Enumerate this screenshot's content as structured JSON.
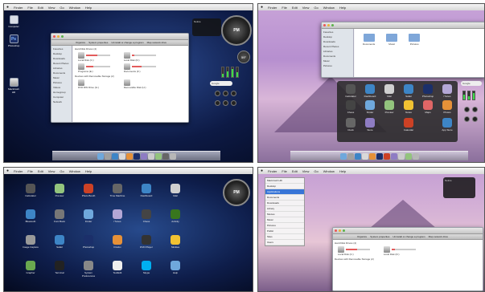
{
  "menubar": {
    "apple": "",
    "items": [
      "Finder",
      "File",
      "Edit",
      "View",
      "Go",
      "Window",
      "Help"
    ]
  },
  "panel1": {
    "desktop_icons": [
      "Computer",
      "Photoshop",
      "Macintosh HD"
    ],
    "window": {
      "tabs": [
        "Organize",
        "System properties",
        "Uninstall or change a program",
        "Map network drive"
      ],
      "sidebar": [
        "Favorites",
        "Desktop",
        "Downloads",
        "Recent Places",
        "Libraries",
        "Documents",
        "Music",
        "Pictures",
        "Videos",
        "Homegroup",
        "Computer",
        "Network"
      ],
      "hard_disk_header": "Hard Disk Drives (4)",
      "removable_header": "Devices with Removable Storage (2)",
      "drives": [
        {
          "name": "Local Disk (C:)",
          "free": 0.55
        },
        {
          "name": "Local Disk (D:)",
          "free": 0.88
        },
        {
          "name": "Programs (E:)",
          "free": 0.7
        },
        {
          "name": "Documents (F:)",
          "free": 0.6
        }
      ],
      "removable": [
        "DVD RW Drive (G:)",
        "Removable Disk (H:)"
      ]
    },
    "clock": "PM",
    "temp": "59°",
    "search": "Google",
    "meters": [
      0.35,
      0.6,
      0.85,
      0.5
    ],
    "notice": "Notice"
  },
  "panel2": {
    "finder_sidebar": [
      "Favorites",
      "Desktop",
      "Downloads",
      "Recent Places",
      "Libraries",
      "Documents",
      "Music",
      "Pictures"
    ],
    "folders": [
      "Documents",
      "Music",
      "Pictures"
    ],
    "search": "Google",
    "launchpad_labels": [
      "Calculator",
      "Dashboard",
      "Mail",
      "Safari",
      "Photoshop",
      "iTunes",
      "Chess",
      "Finder",
      "Preview",
      "Notes",
      "Maps",
      "Photos",
      "Clock",
      "Store",
      "Calendar",
      "App Store"
    ]
  },
  "panel3": {
    "app_labels": [
      "Calculator",
      "Preview",
      "Photo Booth",
      "Time Machine",
      "Dashboard",
      "Mail",
      "Bluetooth",
      "Font Book",
      "Finder",
      "iTunes",
      "Chess",
      "Activity",
      "Image Capture",
      "Safari",
      "Photoshop",
      "Firefox",
      "DVD Player",
      "Stickies",
      "Grapher",
      "Terminal",
      "System Preferences",
      "TextEdit",
      "Skype",
      "Help"
    ],
    "clock": "PM"
  },
  "panel4": {
    "stack_items": [
      "Macintosh HD",
      "Desktop",
      "Applications",
      "Documents",
      "Downloads",
      "Library",
      "Movies",
      "Music",
      "Pictures",
      "Public",
      "Sites",
      "Users"
    ],
    "selected_item": "Applications",
    "window": {
      "tabs": [
        "Organize",
        "System properties",
        "Uninstall or change a program",
        "Map network drive"
      ],
      "hard_disk_header": "Hard Disk Drives (4)",
      "removable_header": "Devices with Removable Storage (2)",
      "drives": [
        {
          "name": "Local Disk (C:)",
          "free": 0.55
        },
        {
          "name": "Local Disk (D:)",
          "free": 0.85
        }
      ]
    },
    "notice": "Notice"
  }
}
